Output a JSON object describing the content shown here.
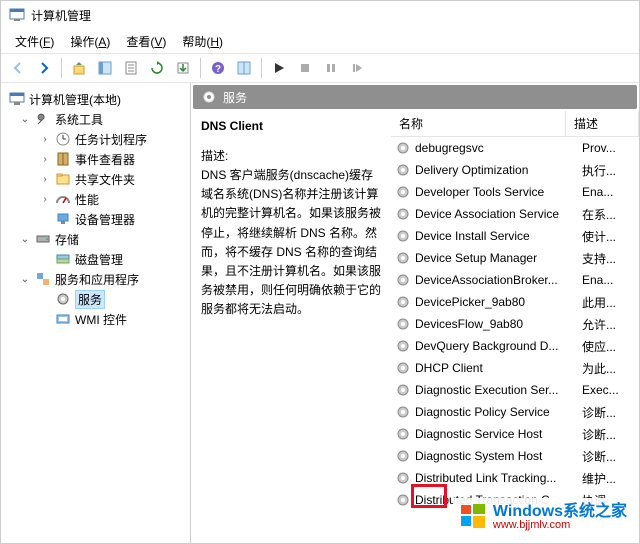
{
  "window": {
    "title": "计算机管理"
  },
  "menubar": {
    "file": "文件(F)",
    "action": "操作(A)",
    "view": "查看(V)",
    "help": "帮助(H)"
  },
  "tree": {
    "root": "计算机管理(本地)",
    "system_tools": "系统工具",
    "task_scheduler": "任务计划程序",
    "event_viewer": "事件查看器",
    "shared_folders": "共享文件夹",
    "performance": "性能",
    "device_manager": "设备管理器",
    "storage": "存储",
    "disk_management": "磁盘管理",
    "services_apps": "服务和应用程序",
    "services": "服务",
    "wmi": "WMI 控件"
  },
  "detail": {
    "header": "服务",
    "selected_name": "DNS Client",
    "desc_label": "描述:",
    "desc": "DNS 客户端服务(dnscache)缓存域名系统(DNS)名称并注册该计算机的完整计算机名。如果该服务被停止，将继续解析 DNS 名称。然而，将不缓存 DNS 名称的查询结果，且不注册计算机名。如果该服务被禁用，则任何明确依赖于它的服务都将无法启动。",
    "columns": {
      "name": "名称",
      "desc": "描述"
    },
    "services": [
      {
        "name": "debugregsvc",
        "desc": "Prov..."
      },
      {
        "name": "Delivery Optimization",
        "desc": "执行..."
      },
      {
        "name": "Developer Tools Service",
        "desc": "Ena..."
      },
      {
        "name": "Device Association Service",
        "desc": "在系..."
      },
      {
        "name": "Device Install Service",
        "desc": "使计..."
      },
      {
        "name": "Device Setup Manager",
        "desc": "支持..."
      },
      {
        "name": "DeviceAssociationBroker...",
        "desc": "Ena..."
      },
      {
        "name": "DevicePicker_9ab80",
        "desc": "此用..."
      },
      {
        "name": "DevicesFlow_9ab80",
        "desc": "允许..."
      },
      {
        "name": "DevQuery Background D...",
        "desc": "使应..."
      },
      {
        "name": "DHCP Client",
        "desc": "为此..."
      },
      {
        "name": "Diagnostic Execution Ser...",
        "desc": "Exec..."
      },
      {
        "name": "Diagnostic Policy Service",
        "desc": "诊断..."
      },
      {
        "name": "Diagnostic Service Host",
        "desc": "诊断..."
      },
      {
        "name": "Diagnostic System Host",
        "desc": "诊断..."
      },
      {
        "name": "Distributed Link Tracking...",
        "desc": "维护..."
      },
      {
        "name": "Distributed Transaction C",
        "desc": "协调"
      }
    ]
  },
  "watermark": {
    "title": "Windows系统之家",
    "url": "www.bjjmlv.com"
  }
}
